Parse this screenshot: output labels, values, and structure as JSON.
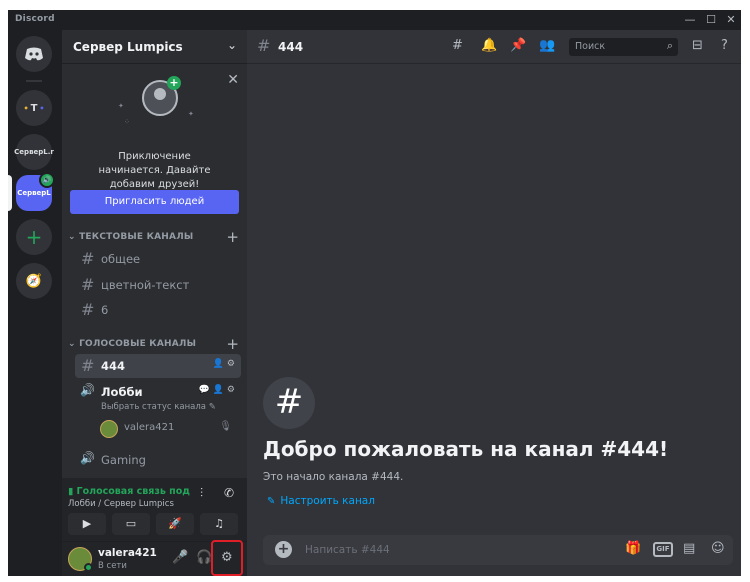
{
  "app": {
    "title": "Discord"
  },
  "window_controls": {
    "minimize": "—",
    "maximize": "☐",
    "close": "✕"
  },
  "servers": [
    {
      "label": "T",
      "kind": "server"
    },
    {
      "label": "СерверL.r",
      "kind": "server"
    },
    {
      "label": "СерверL",
      "kind": "server",
      "active": true,
      "voice_badge": "🔊"
    }
  ],
  "rail": {
    "add_label": "+",
    "explore_label": "🧭"
  },
  "sidebar": {
    "server_name": "Сервер Lumpics",
    "chevron": "⌄",
    "invite": {
      "text": "Приключение начинается. Давайте добавим друзей!",
      "button": "Пригласить людей",
      "close": "✕",
      "plus": "+"
    },
    "text_category": "ТЕКСТОВЫЕ КАНАЛЫ",
    "voice_category": "ГОЛОСОВЫЕ КАНАЛЫ",
    "text_channels": [
      "общее",
      "цветной-текст",
      "6"
    ],
    "voice_channels": [
      {
        "name": "444",
        "selected": true
      },
      {
        "name": "Лобби",
        "sub": "Выбрать статус канала ✎"
      },
      {
        "name": "Gaming"
      }
    ],
    "voice_user": "valera421"
  },
  "voice_panel": {
    "status": "Голосовая связь под",
    "location": "Лобби / Сервер Lumpics"
  },
  "user_panel": {
    "username": "valera421",
    "status": "В сети"
  },
  "main": {
    "channel_name": "444",
    "search_placeholder": "Поиск",
    "welcome_title": "Добро пожаловать на канал #444!",
    "welcome_sub": "Это начало канала #444.",
    "setup_link": "Настроить канал",
    "composer_placeholder": "Написать #444",
    "gif_label": "GIF"
  },
  "colors": {
    "accent": "#5865f2",
    "online": "#23a55a",
    "link": "#00a8fc",
    "highlight": "#e01e28"
  }
}
